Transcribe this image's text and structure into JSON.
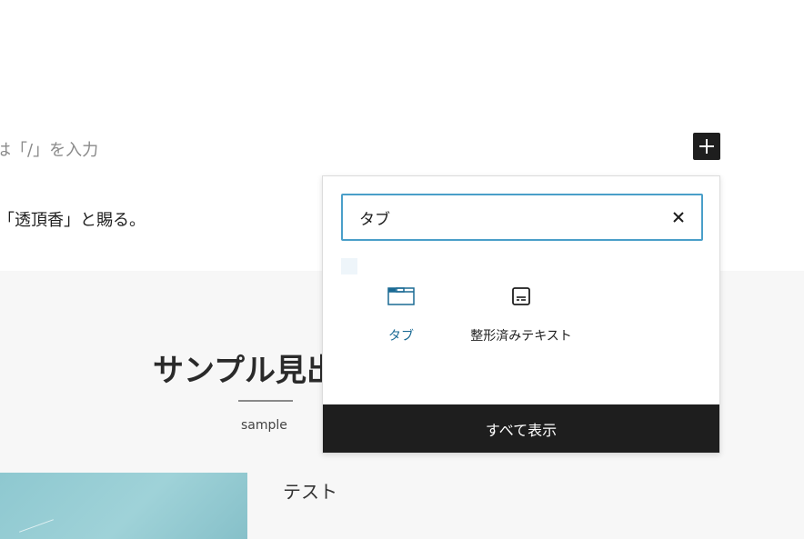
{
  "editor": {
    "placeholder_text": "は「/」を入力",
    "paragraph_text": "「透頂香」と賜る。",
    "section_heading": "サンプル見出",
    "section_subheading": "sample",
    "media_text": "テスト"
  },
  "inserter": {
    "search_value": "タブ",
    "search_placeholder": "",
    "results": [
      {
        "label": "タブ",
        "icon": "tabs-icon"
      },
      {
        "label": "整形済みテキスト",
        "icon": "preformatted-icon"
      }
    ],
    "show_all_label": "すべて表示"
  },
  "colors": {
    "accent": "#4a9fc9",
    "dark": "#1e1e1e",
    "link": "#1a6a94"
  }
}
